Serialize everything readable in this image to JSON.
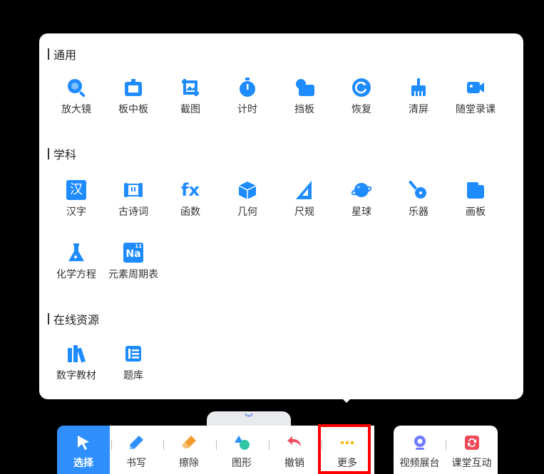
{
  "sections": [
    {
      "title": "通用",
      "tools": [
        {
          "label": "放大镜",
          "icon": "magnifier-icon"
        },
        {
          "label": "板中板",
          "icon": "board-in-board-icon"
        },
        {
          "label": "截图",
          "icon": "screenshot-icon"
        },
        {
          "label": "计时",
          "icon": "timer-icon"
        },
        {
          "label": "挡板",
          "icon": "baffle-icon"
        },
        {
          "label": "恢复",
          "icon": "restore-icon"
        },
        {
          "label": "清屏",
          "icon": "clear-screen-icon"
        },
        {
          "label": "随堂录课",
          "icon": "video-record-icon"
        }
      ]
    },
    {
      "title": "学科",
      "tools": [
        {
          "label": "汉字",
          "icon": "chinese-character-icon",
          "glyph": "汉"
        },
        {
          "label": "古诗词",
          "icon": "scroll-icon"
        },
        {
          "label": "函数",
          "icon": "function-icon",
          "glyph": "fx"
        },
        {
          "label": "几何",
          "icon": "cube-icon"
        },
        {
          "label": "尺规",
          "icon": "ruler-icon"
        },
        {
          "label": "星球",
          "icon": "planet-icon"
        },
        {
          "label": "乐器",
          "icon": "guitar-icon"
        },
        {
          "label": "画板",
          "icon": "drawing-board-icon"
        },
        {
          "label": "化学方程",
          "icon": "flask-icon"
        },
        {
          "label": "元素周期表",
          "icon": "periodic-table-icon",
          "glyph": "Na",
          "glyph_sup": "11"
        }
      ]
    },
    {
      "title": "在线资源",
      "tools": [
        {
          "label": "数字教材",
          "icon": "books-icon"
        },
        {
          "label": "题库",
          "icon": "question-bank-icon"
        }
      ]
    }
  ],
  "collapse_glyph": "︾",
  "toolbar": [
    {
      "label": "选择",
      "icon": "cursor-icon",
      "active": true
    },
    {
      "label": "书写",
      "icon": "pen-icon"
    },
    {
      "label": "擦除",
      "icon": "eraser-icon"
    },
    {
      "label": "图形",
      "icon": "shapes-icon"
    },
    {
      "label": "撤销",
      "icon": "undo-icon"
    },
    {
      "label": "更多",
      "icon": "more-icon",
      "highlighted": true
    }
  ],
  "toolbar_right": [
    {
      "label": "视频展台",
      "icon": "webcam-icon"
    },
    {
      "label": "课堂互动",
      "icon": "interaction-icon"
    }
  ],
  "colors": {
    "accent": "#2f8fff",
    "icon_blue": "#1e8bff",
    "highlight": "#ff0000"
  }
}
